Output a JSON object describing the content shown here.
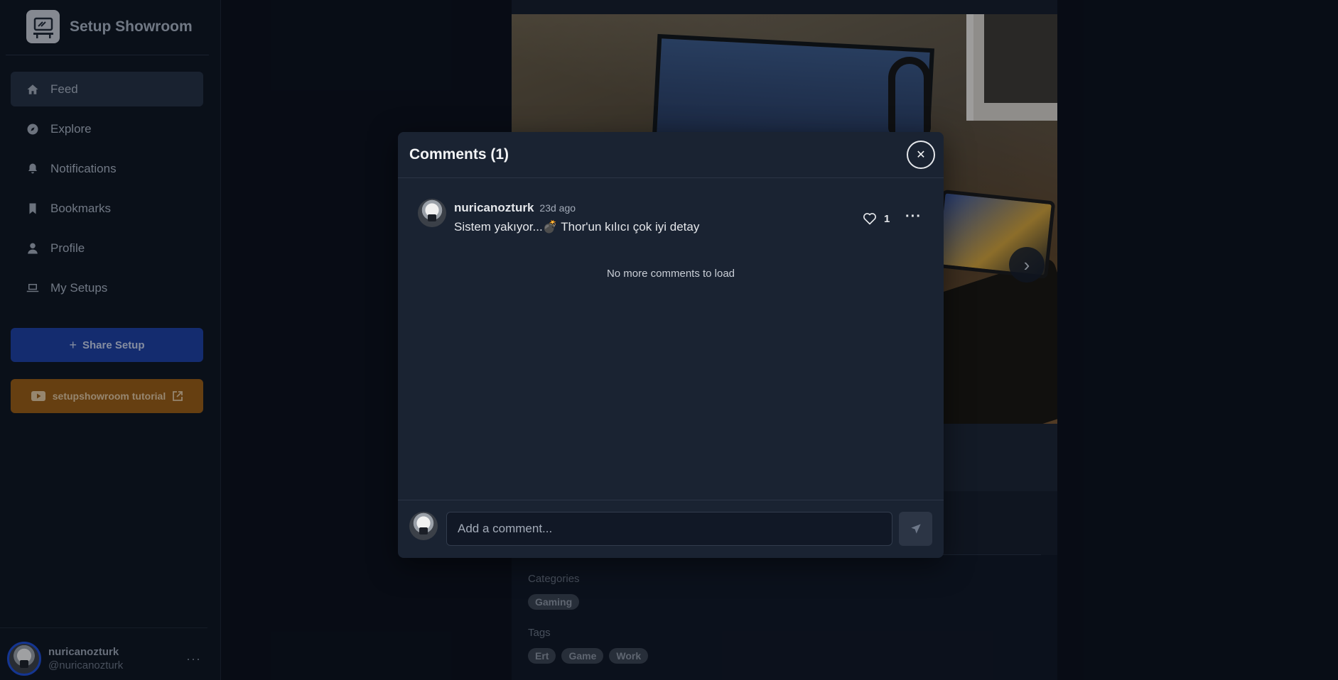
{
  "brand": {
    "title": "Setup Showroom",
    "logo_icon": "desk-setup-icon"
  },
  "sidebar": {
    "items": [
      {
        "label": "Feed",
        "icon": "home-icon",
        "active": true
      },
      {
        "label": "Explore",
        "icon": "compass-icon",
        "active": false
      },
      {
        "label": "Notifications",
        "icon": "bell-icon",
        "active": false
      },
      {
        "label": "Bookmarks",
        "icon": "bookmark-icon",
        "active": false
      },
      {
        "label": "Profile",
        "icon": "user-icon",
        "active": false
      },
      {
        "label": "My Setups",
        "icon": "laptop-icon",
        "active": false
      }
    ],
    "share_label": "Share Setup",
    "tutorial_label": "setupshowroom tutorial",
    "user": {
      "name": "nuricanozturk",
      "handle": "@nuricanozturk"
    }
  },
  "post": {
    "categories_label": "Categories",
    "categories": [
      "Gaming"
    ],
    "tags_label": "Tags",
    "tags": [
      "Ert",
      "Game",
      "Work"
    ]
  },
  "modal": {
    "title": "Comments (1)",
    "comments": [
      {
        "user": "nuricanozturk",
        "time": "23d ago",
        "text": "Sistem yakıyor...💣 Thor'un kılıcı çok iyi detay",
        "likes": "1"
      }
    ],
    "no_more": "No more comments to load",
    "input_placeholder": "Add a comment..."
  },
  "colors": {
    "primary": "#1d3fa3",
    "tutorial": "#9a5c13",
    "modal_bg": "#1a2332",
    "sidebar_bg": "#0d1420"
  }
}
